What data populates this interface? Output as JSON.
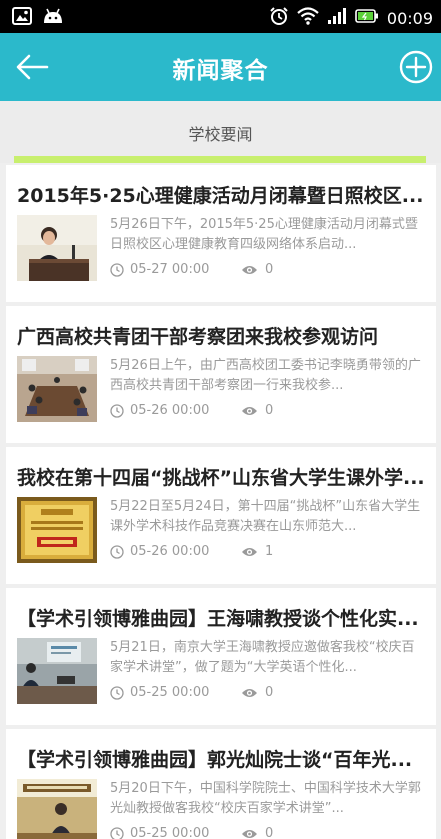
{
  "status_bar": {
    "time": "00:09",
    "icons": [
      "image-notification-icon",
      "android-icon",
      "alarm-icon",
      "wifi-icon",
      "signal-icon",
      "battery-icon"
    ]
  },
  "app_bar": {
    "title": "新闻聚合",
    "back_icon": "arrow-left-icon",
    "add_icon": "plus-circle-icon",
    "background": "#2bb9cb"
  },
  "tab": {
    "label": "学校要闻",
    "indicator_color": "#c8ef6e"
  },
  "news": [
    {
      "title": "2015年5·25心理健康活动月闭幕暨日照校区...",
      "summary": "5月26日下午，2015年5·25心理健康活动月闭幕式暨日照校区心理健康教育四级网络体系启动...",
      "date": "05-27 00:00",
      "views": "0",
      "thumb": "woman-at-podium"
    },
    {
      "title": "广西高校共青团干部考察团来我校参观访问",
      "summary": "5月26日上午，由广西高校团工委书记李晓勇带领的广西高校共青团干部考察团一行来我校参...",
      "date": "05-26 00:00",
      "views": "0",
      "thumb": "meeting-room"
    },
    {
      "title": "我校在第十四届“挑战杯”山东省大学生课外学...",
      "summary": "5月22日至5月24日，第十四届“挑战杯”山东省大学生课外学术科技作品竞赛决赛在山东师范大...",
      "date": "05-26 00:00",
      "views": "1",
      "thumb": "award-certificate"
    },
    {
      "title": "【学术引领博雅曲园】王海啸教授谈个性化实...",
      "summary": "5月21日，南京大学王海啸教授应邀做客我校“校庆百家学术讲堂”，做了题为“大学英语个性化...",
      "date": "05-25 00:00",
      "views": "0",
      "thumb": "lecture-hall"
    },
    {
      "title": "【学术引领博雅曲园】郭光灿院士谈“百年光...",
      "summary": "5月20日下午，中国科学院院士、中国科学技术大学郭光灿教授做客我校“校庆百家学术讲堂”...",
      "date": "05-25 00:00",
      "views": "0",
      "thumb": "lecture-banner"
    }
  ]
}
